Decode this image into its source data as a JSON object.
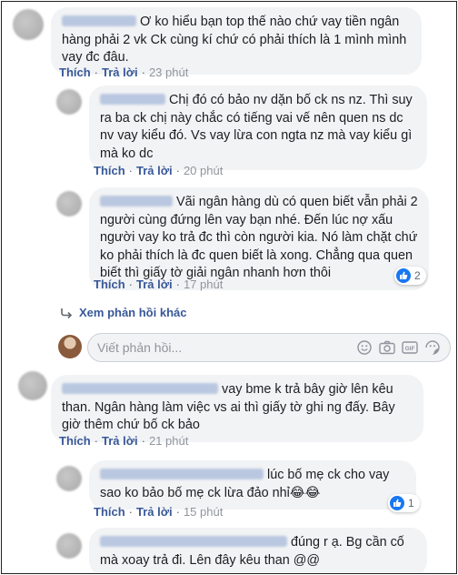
{
  "comments": [
    {
      "text": "Ơ ko hiểu bạn top thế nào chứ vay tiền ngân hàng phải 2 vk Ck cùng kí chứ có phải thích là 1 mình mình vay đc đâu.",
      "like_label": "Thích",
      "reply_label": "Trả lời",
      "time": "23 phút"
    },
    {
      "text": "Chị đó có bảo nv dặn bố ck ns nz. Thì suy ra ba ck chị này chắc có tiếng vai vế nên quen ns dc nv vay kiểu đó. Vs vay lừa con ngta nz mà vay kiểu gì mà ko dc",
      "like_label": "Thích",
      "reply_label": "Trả lời",
      "time": "20 phút"
    },
    {
      "text": "Vãi ngân hàng dù có quen biết vẫn phải 2 người cùng đứng lên vay bạn nhé. Đến lúc nợ xấu người vay ko trả đc thì còn người kia. Nó làm chặt chứ ko phải thích là đc quen biết là xong. Chẳng qua quen biết thì giấy tờ giải ngân nhanh hơn thôi",
      "like_label": "Thích",
      "reply_label": "Trả lời",
      "time": "17 phút",
      "reaction_count": "2"
    },
    {
      "text": "vay bme k trả bây giờ lên kêu than. Ngân hàng làm việc vs ai thì giấy tờ ghi ng đấy. Bây giờ thêm chứ bố ck bảo",
      "like_label": "Thích",
      "reply_label": "Trả lời",
      "time": "21 phút"
    },
    {
      "text": "lúc bố mẹ ck cho vay sao ko bảo bố mẹ ck lừa đảo nhỉ😂😂",
      "like_label": "Thích",
      "reply_label": "Trả lời",
      "time": "15 phút",
      "reaction_count": "1"
    },
    {
      "text": "đúng r ạ. Bg cần cố mà xoay trả đi. Lên đây kêu than @@"
    }
  ],
  "more_replies": "Xem phản hồi khác",
  "reply_input": {
    "placeholder": "Viết phản hồi..."
  },
  "icons": [
    "emoji-icon",
    "camera-icon",
    "gif-icon",
    "sticker-icon",
    "like-icon",
    "reply-arrow-icon"
  ],
  "colors": {
    "link": "#385898",
    "bubble": "#f2f3f5",
    "like": "#1877f2"
  }
}
